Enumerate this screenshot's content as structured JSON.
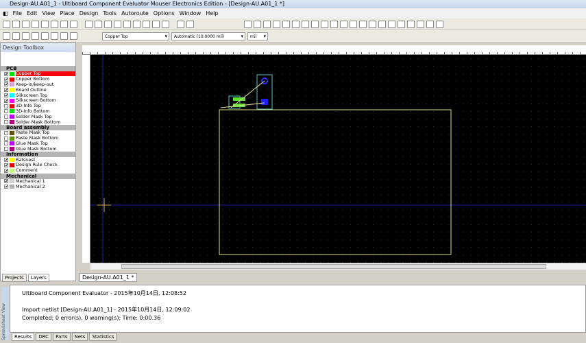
{
  "window": {
    "title": "Design-AU.A01_1 - Ultiboard Component Evaluator Mouser Electronics Edition - [Design-AU.A01_1 *]"
  },
  "menu": [
    "File",
    "Edit",
    "View",
    "Place",
    "Design",
    "Tools",
    "Autoroute",
    "Options",
    "Window",
    "Help"
  ],
  "toolbar": {
    "layer_select": "Copper Top",
    "grid_select": "Automatic (10.0000 mil)",
    "unit_select": "mil"
  },
  "toolbox": {
    "title": "Design Toolbox",
    "groups": [
      {
        "name": "PCB",
        "items": [
          {
            "label": "Copper Top",
            "checked": true,
            "color": "#00e000",
            "selected": true
          },
          {
            "label": "Copper Bottom",
            "checked": true,
            "color": "#e00000"
          },
          {
            "label": "Keep-in/keep-out",
            "checked": true,
            "color": "#d8a0d8"
          },
          {
            "label": "Board Outline",
            "checked": true,
            "color": "#ffff00"
          },
          {
            "label": "Silkscreen Top",
            "checked": true,
            "color": "#00ffff"
          },
          {
            "label": "Silkscreen Bottom",
            "checked": true,
            "color": "#ff00ff"
          },
          {
            "label": "3D-Info Top",
            "checked": false,
            "color": "#e00000"
          },
          {
            "label": "3D-Info Bottom",
            "checked": false,
            "color": "#00e000"
          },
          {
            "label": "Solder Mask Top",
            "checked": false,
            "color": "#c000ff"
          },
          {
            "label": "Solder Mask Bottom",
            "checked": false,
            "color": "#b00080"
          }
        ]
      },
      {
        "name": "Board assembly",
        "items": [
          {
            "label": "Paste Mask Top",
            "checked": false,
            "color": "#605000"
          },
          {
            "label": "Paste Mask Bottom",
            "checked": false,
            "color": "#609000"
          },
          {
            "label": "Glue Mask Top",
            "checked": false,
            "color": "#c000ff"
          },
          {
            "label": "Glue Mask Bottom",
            "checked": false,
            "color": "#b00080"
          }
        ]
      },
      {
        "name": "Information",
        "items": [
          {
            "label": "Ratsnest",
            "checked": true,
            "color": "#ffff00"
          },
          {
            "label": "Design Rule Check",
            "checked": true,
            "color": "#e00000"
          },
          {
            "label": "Comment",
            "checked": true,
            "color": "#c0ff80"
          }
        ]
      },
      {
        "name": "Mechanical",
        "items": [
          {
            "label": "Mechanical 1",
            "checked": true,
            "color": "#d0d0d0"
          },
          {
            "label": "Mechanical 2",
            "checked": true,
            "color": "#b0b0b0"
          }
        ]
      }
    ],
    "tabs": [
      "Projects",
      "Layers"
    ]
  },
  "document_tab": "Design-AU.A01_1 *",
  "output": {
    "side_label": "Spreadsheet View",
    "lines": [
      "Ultiboard Component Evaluator  -  2015年10月14日, 12:08:52",
      "",
      "Import netlist [Design-AU.A01_1]  -  2015年10月14日, 12:09:02",
      "Completed;  0 error(s), 0 warning(s);  Time: 0:00.36"
    ],
    "tabs": [
      "Results",
      "DRC",
      "Parts",
      "Nets",
      "Statistics"
    ]
  }
}
